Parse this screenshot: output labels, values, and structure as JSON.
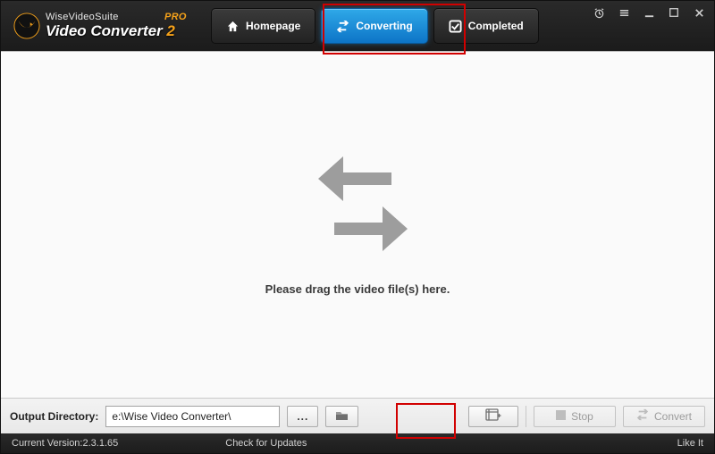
{
  "brand": {
    "suite": "WiseVideoSuite",
    "name": "Video Converter",
    "num": "2",
    "pro": "PRO"
  },
  "tabs": {
    "home": "Homepage",
    "converting": "Converting",
    "completed": "Completed"
  },
  "main": {
    "drop_hint": "Please drag the video file(s) here."
  },
  "bottom": {
    "dir_label": "Output Directory:",
    "path": "e:\\Wise Video Converter\\",
    "browse": "...",
    "stop": "Stop",
    "convert": "Convert"
  },
  "status": {
    "version_label": "Current Version:",
    "version": "2.3.1.65",
    "updates": "Check for Updates",
    "like": "Like It"
  },
  "colors": {
    "accent": "#1b8bd6",
    "brand_orange": "#f6a21a",
    "highlight": "#d10000"
  }
}
